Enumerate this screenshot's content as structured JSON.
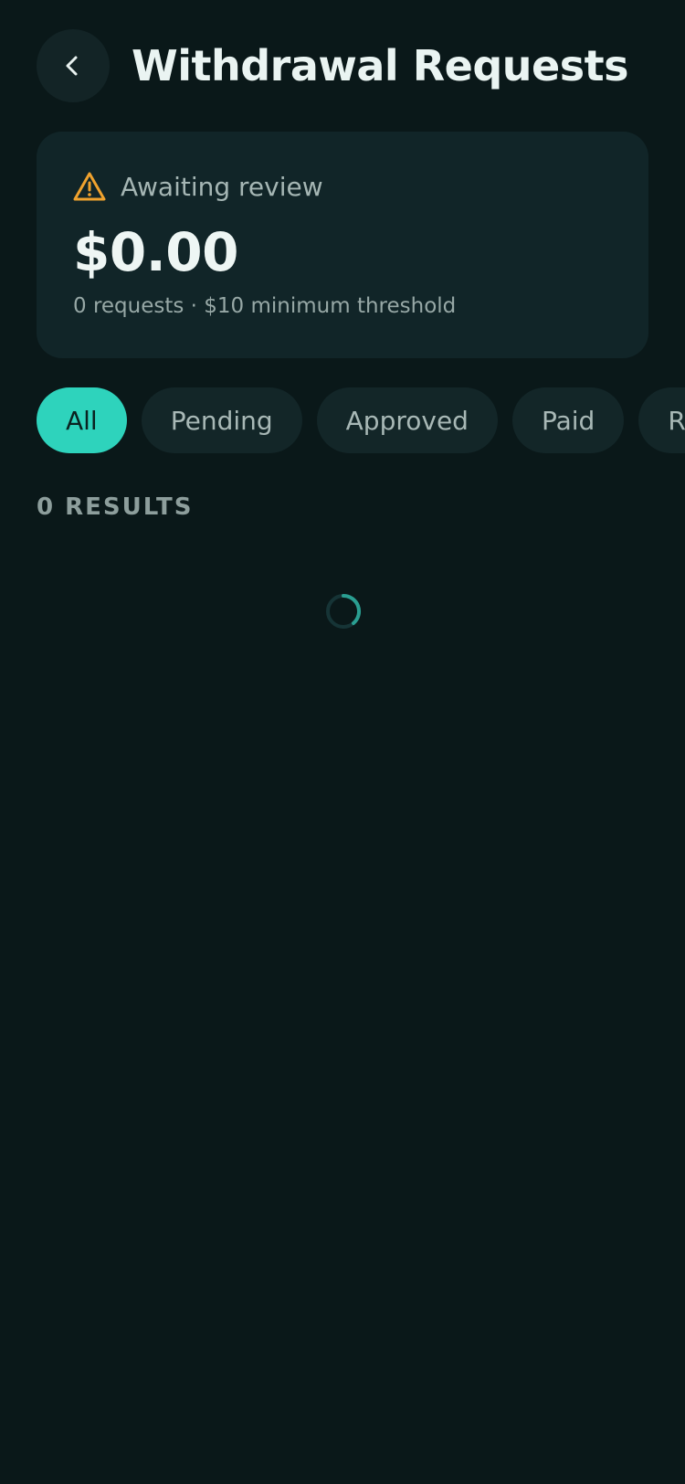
{
  "header": {
    "title": "Withdrawal Requests",
    "back_icon": "chevron-left-icon"
  },
  "summary": {
    "icon": "warning-icon",
    "label": "Awaiting review",
    "amount": "$0.00",
    "subtext": "0 requests · $10 minimum threshold"
  },
  "filters": {
    "items": [
      {
        "label": "All",
        "active": true
      },
      {
        "label": "Pending",
        "active": false
      },
      {
        "label": "Approved",
        "active": false
      },
      {
        "label": "Paid",
        "active": false
      },
      {
        "label": "Rejected",
        "active": false
      }
    ]
  },
  "results": {
    "count_label": "0 RESULTS"
  },
  "loading": {
    "icon": "loading-spinner-icon"
  },
  "colors": {
    "background": "#0a1819",
    "card": "#112528",
    "accent": "#2ed3bc",
    "warning": "#f0a22e"
  }
}
